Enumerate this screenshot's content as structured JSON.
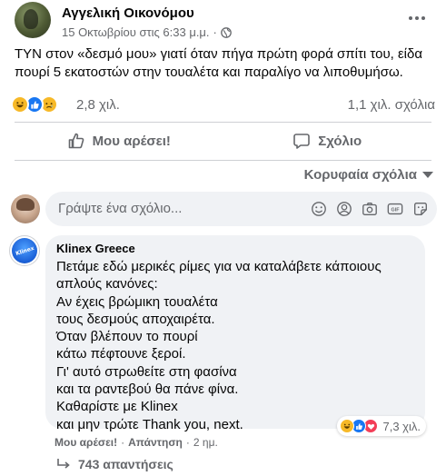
{
  "post": {
    "author": "Αγγελική Οικονόμου",
    "date": "15 Οκτωβρίου στις 6:33 μ.μ.",
    "separator": "·",
    "text": "TYN στον «δεσμό μου» γιατί όταν πήγα πρώτη φορά σπίτι του, είδα πουρί 5 εκατοστών στην τουαλέτα και παραλίγο να λιποθυμήσω.",
    "reactions_count": "2,8 χιλ.",
    "comments_count": "1,1 χιλ. σχόλια",
    "reaction_icons": [
      "haha-icon",
      "like-icon",
      "sad-icon"
    ]
  },
  "actions": {
    "like_label": "Μου αρέσει!",
    "comment_label": "Σχόλιο"
  },
  "sort": {
    "label": "Κορυφαία σχόλια"
  },
  "composer": {
    "placeholder": "Γράψτε ένα σχόλιο..."
  },
  "comment": {
    "author": "Klinex Greece",
    "lines": [
      "Πετάμε εδώ μερικές ρίμες για να καταλάβετε κάποιους",
      "απλούς κανόνες:",
      "Αν έχεις βρώμικη τουαλέτα",
      "τους δεσμούς αποχαιρέτα.",
      "Όταν βλέπουν το πουρί",
      "κάτω πέφτουνε ξεροί.",
      "Γι' αυτό στρωθείτε στη φασίνα",
      "και τα ραντεβού θα πάνε φίνα.",
      "Καθαρίστε με Klinex",
      "και μην τρώτε Thank you, next."
    ],
    "reactions_count": "7,3 χιλ.",
    "like_label": "Μου αρέσει!",
    "reply_label": "Απάντηση",
    "time": "2 ημ.",
    "dot": "·",
    "replies_label": "743 απαντήσεις"
  },
  "colors": {
    "secondary_text": "#65676b",
    "bubble_bg": "#f0f2f5",
    "like_blue": "#1877f2",
    "emoji_yellow": "#f7b928",
    "love_red": "#f33e58"
  }
}
